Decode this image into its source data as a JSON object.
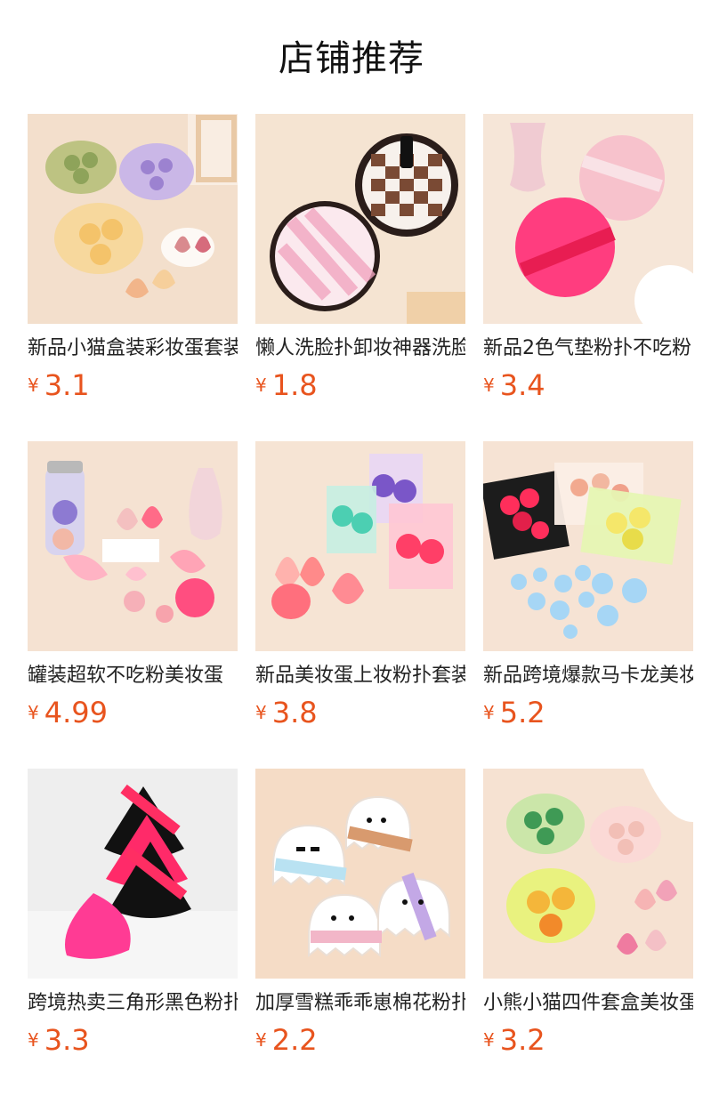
{
  "title": "店铺推荐",
  "currency": "¥",
  "products": [
    {
      "name": "新品小猫盒装彩妆蛋套装",
      "price": "3.1",
      "image": "cat-box-sponges"
    },
    {
      "name": "懒人洗脸扑卸妆神器洗脸巾",
      "price": "1.8",
      "image": "face-wash-puffs"
    },
    {
      "name": "新品2色气垫粉扑不吃粉",
      "price": "3.4",
      "image": "cushion-puffs"
    },
    {
      "name": "罐装超软不吃粉美妆蛋",
      "price": "4.99",
      "image": "jar-sponges"
    },
    {
      "name": "新品美妆蛋上妆粉扑套装",
      "price": "3.8",
      "image": "boxed-sponges"
    },
    {
      "name": "新品跨境爆款马卡龙美妆蛋",
      "price": "5.2",
      "image": "bag-sponges"
    },
    {
      "name": "跨境热卖三角形黑色粉扑",
      "price": "3.3",
      "image": "triangle-puffs"
    },
    {
      "name": "加厚雪糕乖乖崽棉花粉扑",
      "price": "2.2",
      "image": "ghost-puffs"
    },
    {
      "name": "小熊小猫四件套盒美妆蛋",
      "price": "3.2",
      "image": "bear-box-sponges"
    }
  ]
}
